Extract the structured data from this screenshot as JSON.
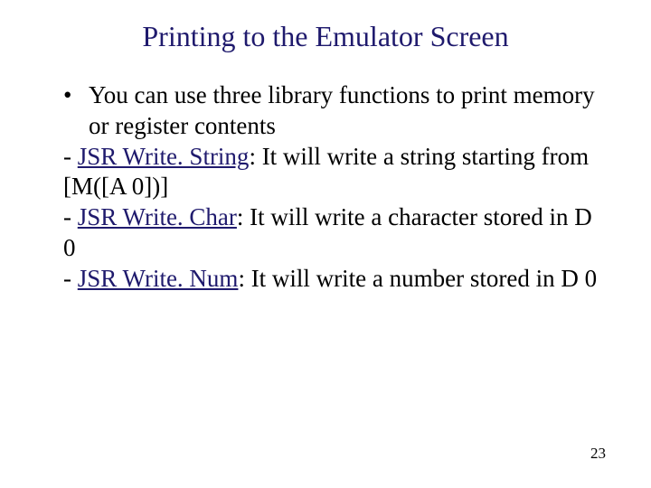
{
  "title": "Printing to the Emulator Screen",
  "bullet": {
    "marker": "•",
    "text": "You can use three library functions to print memory or register contents"
  },
  "items": [
    {
      "dash": "- ",
      "jsr": "JSR Write. String",
      "after": ": It will write a string starting from [M([A 0])]"
    },
    {
      "dash": "- ",
      "jsr": "JSR Write. Char",
      "after": ": It will write a character stored in D 0"
    },
    {
      "dash": "- ",
      "jsr": "JSR Write. Num",
      "after": ": It will write a number stored in D 0"
    }
  ],
  "page_number": "23"
}
